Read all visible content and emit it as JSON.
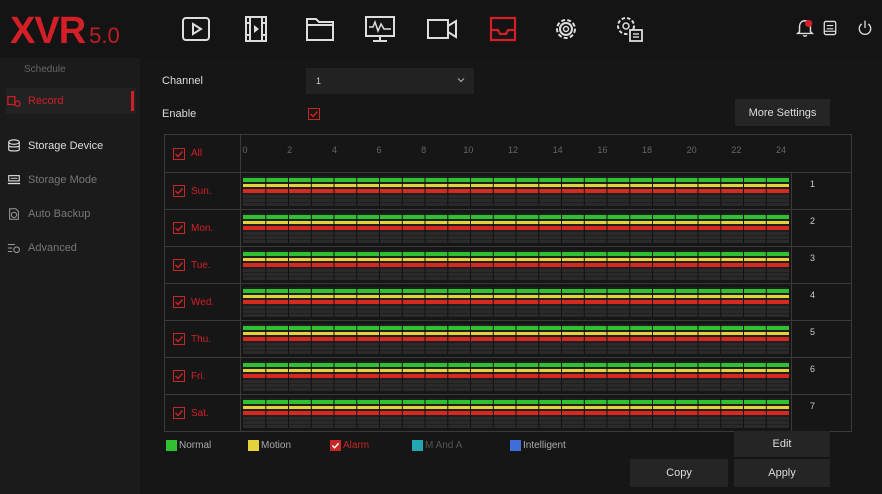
{
  "app": {
    "logo_text": "XVR",
    "logo_version": "5.0",
    "brand_color": "#d31f28"
  },
  "nav": [
    {
      "name": "playback-icon"
    },
    {
      "name": "video-file-icon"
    },
    {
      "name": "folder-icon"
    },
    {
      "name": "monitor-icon"
    },
    {
      "name": "camera-icon"
    },
    {
      "name": "storage-icon",
      "active": true
    },
    {
      "name": "settings-icon"
    },
    {
      "name": "system-settings-icon"
    }
  ],
  "top_right": [
    "alarm-bell-icon",
    "notes-icon",
    "power-icon"
  ],
  "sidebar": {
    "section_title": "Schedule",
    "items": [
      {
        "label": "Record",
        "icon": "record-icon",
        "state": "active"
      },
      {
        "label": "Storage Device",
        "icon": "database-icon",
        "state": "bright"
      },
      {
        "label": "Storage Mode",
        "icon": "storage-mode-icon",
        "state": "dim"
      },
      {
        "label": "Auto Backup",
        "icon": "backup-icon",
        "state": "dim"
      },
      {
        "label": "Advanced",
        "icon": "advanced-icon",
        "state": "dim"
      }
    ]
  },
  "form": {
    "channel_label": "Channel",
    "channel_value": "1",
    "enable_label": "Enable",
    "enable_checked": true,
    "more_settings": "More Settings"
  },
  "schedule": {
    "all_label": "All",
    "hours": [
      "0",
      "2",
      "4",
      "6",
      "8",
      "10",
      "12",
      "14",
      "16",
      "18",
      "20",
      "22",
      "24"
    ],
    "days": [
      {
        "label": "Sun.",
        "index": "1"
      },
      {
        "label": "Mon.",
        "index": "2"
      },
      {
        "label": "Tue.",
        "index": "3"
      },
      {
        "label": "Wed.",
        "index": "4"
      },
      {
        "label": "Thu.",
        "index": "5"
      },
      {
        "label": "Fri.",
        "index": "6"
      },
      {
        "label": "Sat.",
        "index": "7"
      }
    ],
    "row_colors": [
      "#2fc12f",
      "#e3d23a",
      "#d62a20"
    ]
  },
  "legend": [
    {
      "label": "Normal",
      "color": "#2fc12f",
      "checked": false
    },
    {
      "label": "Motion",
      "color": "#e3d23a",
      "checked": false
    },
    {
      "label": "Alarm",
      "color": "#c62828",
      "checked": true
    },
    {
      "label": "M And A",
      "color": "#22a6b3",
      "checked": false
    },
    {
      "label": "Intelligent",
      "color": "#3f6fd6",
      "checked": false
    }
  ],
  "buttons": {
    "edit": "Edit",
    "copy": "Copy",
    "apply": "Apply"
  }
}
